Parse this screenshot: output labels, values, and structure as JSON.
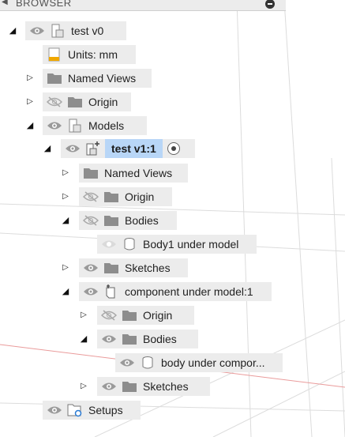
{
  "panel": {
    "title": "BROWSER",
    "collapse_icon": "caret-left-icon",
    "minimize_icon": "minus-circle-icon"
  },
  "colors": {
    "pill_bg": "#ececec",
    "active_highlight": "#b8d6f7",
    "grid_line": "#d9d9d9",
    "axis_line": "#e8a0a0"
  },
  "tree": [
    {
      "id": "n0",
      "label": "test v0",
      "toggle": "down",
      "eye": "visible",
      "icon": "document-icon"
    },
    {
      "id": "n1",
      "label": "Units: mm",
      "toggle": "none",
      "eye": "none",
      "icon": "ruler-icon"
    },
    {
      "id": "n2",
      "label": "Named Views",
      "toggle": "right",
      "eye": "none",
      "icon": "folder-icon"
    },
    {
      "id": "n3",
      "label": "Origin",
      "toggle": "right",
      "eye": "hidden",
      "icon": "folder-icon"
    },
    {
      "id": "n4",
      "label": "Models",
      "toggle": "down",
      "eye": "visible",
      "icon": "document-icon"
    },
    {
      "id": "n5",
      "label": "test v1:1",
      "toggle": "down",
      "eye": "visible",
      "icon": "linked-component-icon",
      "active": true
    },
    {
      "id": "n6",
      "label": "Named Views",
      "toggle": "right",
      "eye": "none",
      "icon": "folder-icon"
    },
    {
      "id": "n7",
      "label": "Origin",
      "toggle": "right",
      "eye": "hidden",
      "icon": "folder-icon"
    },
    {
      "id": "n8",
      "label": "Bodies",
      "toggle": "down",
      "eye": "hidden",
      "icon": "folder-icon"
    },
    {
      "id": "n9",
      "label": "Body1 under model",
      "toggle": "none",
      "eye": "faded",
      "icon": "body-icon"
    },
    {
      "id": "n10",
      "label": "Sketches",
      "toggle": "right",
      "eye": "visible",
      "icon": "folder-icon"
    },
    {
      "id": "n11",
      "label": "component under model:1",
      "toggle": "down",
      "eye": "visible",
      "icon": "component-icon"
    },
    {
      "id": "n12",
      "label": "Origin",
      "toggle": "right",
      "eye": "hidden",
      "icon": "folder-icon"
    },
    {
      "id": "n13",
      "label": "Bodies",
      "toggle": "down",
      "eye": "visible",
      "icon": "folder-icon"
    },
    {
      "id": "n14",
      "label": "body under compor...",
      "toggle": "none",
      "eye": "visible",
      "icon": "body-icon"
    },
    {
      "id": "n15",
      "label": "Sketches",
      "toggle": "right",
      "eye": "visible",
      "icon": "folder-icon"
    },
    {
      "id": "n16",
      "label": "Setups",
      "toggle": "none",
      "eye": "visible",
      "icon": "setups-icon"
    }
  ]
}
